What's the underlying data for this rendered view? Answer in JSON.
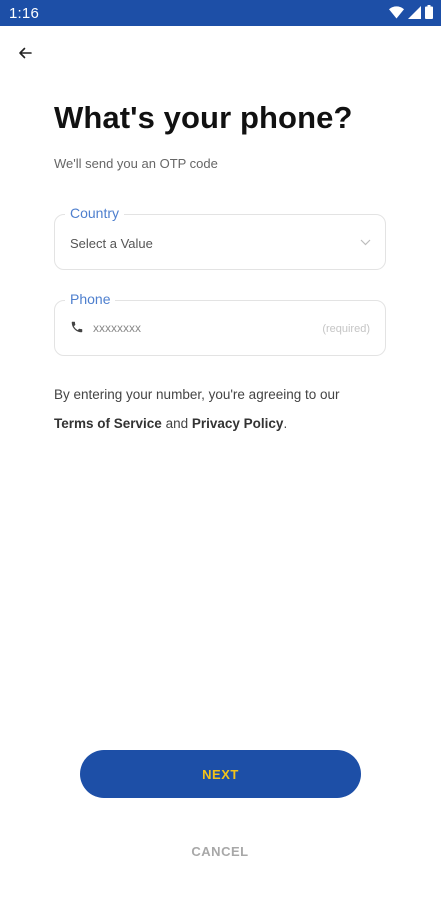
{
  "status_bar": {
    "time": "1:16",
    "icons": [
      "wifi-icon",
      "signal-icon",
      "battery-icon"
    ]
  },
  "header": {
    "back_icon": "arrow-left-icon",
    "title": "What's your phone?",
    "subtitle": "We'll send you an OTP code"
  },
  "country_field": {
    "label": "Country",
    "value": "Select a Value",
    "icon": "chevron-down-icon"
  },
  "phone_field": {
    "label": "Phone",
    "placeholder": "xxxxxxxx",
    "hint": "(required)",
    "icon": "phone-icon"
  },
  "terms": {
    "prefix": "By entering your number, you're agreeing to our",
    "terms_link": "Terms of Service",
    "and": "and",
    "privacy_link": "Privacy Policy",
    "suffix": "."
  },
  "actions": {
    "next_label": "NEXT",
    "cancel_label": "CANCEL"
  },
  "colors": {
    "primary": "#1d4fa7",
    "next_text": "#f2c21b",
    "field_label": "#4e7fce"
  }
}
